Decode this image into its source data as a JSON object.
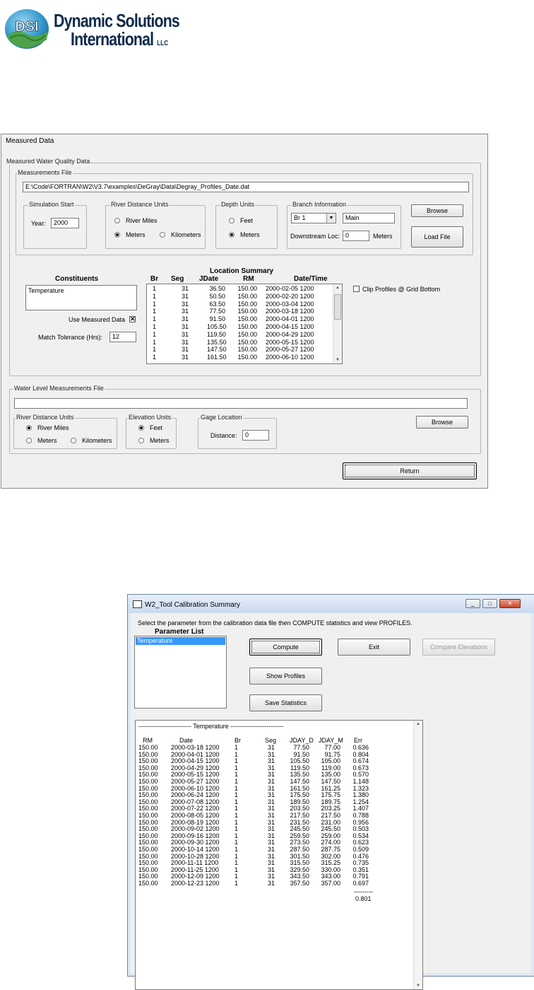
{
  "logo": {
    "mark": "DSI",
    "line1": "Dynamic Solutions",
    "line2": "International",
    "suffix": "LLC"
  },
  "measured": {
    "title": "Measured Data",
    "wq_group": "Measured Water Quality Data",
    "file_group": "Measurements File",
    "file_path": "E:\\Code\\FORTRAN\\W2\\V3.7\\examples\\DeGray\\Data\\Degray_Profiles_Date.dat",
    "sim_start": {
      "label": "Simulation Start",
      "year_label": "Year:",
      "year": "2000"
    },
    "river_units": {
      "label": "River Distance Units",
      "miles": "River Miles",
      "meters": "Meters",
      "km": "Kilometers",
      "selected": "Meters"
    },
    "depth_units": {
      "label": "Depth Units",
      "feet": "Feet",
      "meters": "Meters",
      "selected": "Meters"
    },
    "branch": {
      "label": "Branch Information",
      "branch": "Br 1",
      "name": "Main",
      "downstream_label": "Downstream Loc:",
      "downstream": "0",
      "units": "Meters"
    },
    "browse": "Browse",
    "load_file": "Load File",
    "constituents": {
      "label": "Constituents",
      "items": [
        "Temperature"
      ]
    },
    "use_measured": "Use Measured Data",
    "match_tol": {
      "label": "Match Tolerance (Hrs):",
      "value": "12"
    },
    "location_summary": {
      "title": "Location Summary",
      "headers": [
        "Br",
        "Seg",
        "JDate",
        "RM",
        "Date/Time"
      ],
      "rows": [
        [
          "1",
          "31",
          "36.50",
          "150.00",
          "2000-02-05 1200"
        ],
        [
          "1",
          "31",
          "50.50",
          "150.00",
          "2000-02-20 1200"
        ],
        [
          "1",
          "31",
          "63.50",
          "150.00",
          "2000-03-04 1200"
        ],
        [
          "1",
          "31",
          "77.50",
          "150.00",
          "2000-03-18 1200"
        ],
        [
          "1",
          "31",
          "91.50",
          "150.00",
          "2000-04-01 1200"
        ],
        [
          "1",
          "31",
          "105.50",
          "150.00",
          "2000-04-15 1200"
        ],
        [
          "1",
          "31",
          "119.50",
          "150.00",
          "2000-04-29 1200"
        ],
        [
          "1",
          "31",
          "135.50",
          "150.00",
          "2000-05-15 1200"
        ],
        [
          "1",
          "31",
          "147.50",
          "150.00",
          "2000-05-27 1200"
        ],
        [
          "1",
          "31",
          "161.50",
          "150.00",
          "2000-06-10 1200"
        ]
      ]
    },
    "clip": "Clip Profiles @ Grid Bottom",
    "wl_group": "Water Level Measurements File",
    "wl_path": "",
    "wl_river": {
      "label": "River Distance Units",
      "miles": "River Miles",
      "meters": "Meters",
      "km": "Kilometers",
      "selected": "River Miles"
    },
    "elev": {
      "label": "Elevation Units",
      "feet": "Feet",
      "meters": "Meters",
      "selected": "Feet"
    },
    "gage": {
      "label": "Gage Location",
      "dist_label": "Distance:",
      "dist": "0"
    },
    "wl_browse": "Browse",
    "return": "Return"
  },
  "calib": {
    "title": "W2_Tool Calibration Summary",
    "instructions": "Select the parameter from the calibration data file then COMPUTE statistics and view PROFILES.",
    "param_list_label": "Parameter List",
    "params": [
      "Temperature"
    ],
    "compute": "Compute",
    "exit": "Exit",
    "compare": "Compare Elevations",
    "show_profiles": "Show Profiles",
    "save_stats": "Save Statistics",
    "banner": "------------------------- Temperature -------------------------",
    "headers": [
      "RM",
      "Date",
      "Br",
      "Seg",
      "JDAY_D",
      "JDAY_M",
      "Err"
    ],
    "rows": [
      [
        "150.00",
        "2000-03-18 1200",
        "1",
        "31",
        "77.50",
        "77.00",
        "0.636"
      ],
      [
        "150.00",
        "2000-04-01 1200",
        "1",
        "31",
        "91.50",
        "91.75",
        "0.804"
      ],
      [
        "150.00",
        "2000-04-15 1200",
        "1",
        "31",
        "105.50",
        "105.00",
        "0.674"
      ],
      [
        "150.00",
        "2000-04-29 1200",
        "1",
        "31",
        "119.50",
        "119.00",
        "0.673"
      ],
      [
        "150.00",
        "2000-05-15 1200",
        "1",
        "31",
        "135.50",
        "135.00",
        "0.570"
      ],
      [
        "150.00",
        "2000-05-27 1200",
        "1",
        "31",
        "147.50",
        "147.50",
        "1.148"
      ],
      [
        "150.00",
        "2000-06-10 1200",
        "1",
        "31",
        "161.50",
        "161.25",
        "1.323"
      ],
      [
        "150.00",
        "2000-06-24 1200",
        "1",
        "31",
        "175.50",
        "175.75",
        "1.380"
      ],
      [
        "150.00",
        "2000-07-08 1200",
        "1",
        "31",
        "189.50",
        "189.75",
        "1.254"
      ],
      [
        "150.00",
        "2000-07-22 1200",
        "1",
        "31",
        "203.50",
        "203.25",
        "1.407"
      ],
      [
        "150.00",
        "2000-08-05 1200",
        "1",
        "31",
        "217.50",
        "217.50",
        "0.788"
      ],
      [
        "150.00",
        "2000-08-19 1200",
        "1",
        "31",
        "231.50",
        "231.00",
        "0.956"
      ],
      [
        "150.00",
        "2000-09-02 1200",
        "1",
        "31",
        "245.50",
        "245.50",
        "0.503"
      ],
      [
        "150.00",
        "2000-09-16 1200",
        "1",
        "31",
        "259.50",
        "259.00",
        "0.534"
      ],
      [
        "150.00",
        "2000-09-30 1200",
        "1",
        "31",
        "273.50",
        "274.00",
        "0.623"
      ],
      [
        "150.00",
        "2000-10-14 1200",
        "1",
        "31",
        "287.50",
        "287.75",
        "0.509"
      ],
      [
        "150.00",
        "2000-10-28 1200",
        "1",
        "31",
        "301.50",
        "302.00",
        "0.476"
      ],
      [
        "150.00",
        "2000-11-11 1200",
        "1",
        "31",
        "315.50",
        "315.25",
        "0.735"
      ],
      [
        "150.00",
        "2000-11-25 1200",
        "1",
        "31",
        "329.50",
        "330.00",
        "0.351"
      ],
      [
        "150.00",
        "2000-12-09 1200",
        "1",
        "31",
        "343.50",
        "343.00",
        "0.791"
      ],
      [
        "150.00",
        "2000-12-23 1200",
        "1",
        "31",
        "357.50",
        "357.00",
        "0.697"
      ]
    ],
    "separator": "---------",
    "average": "0.801"
  }
}
